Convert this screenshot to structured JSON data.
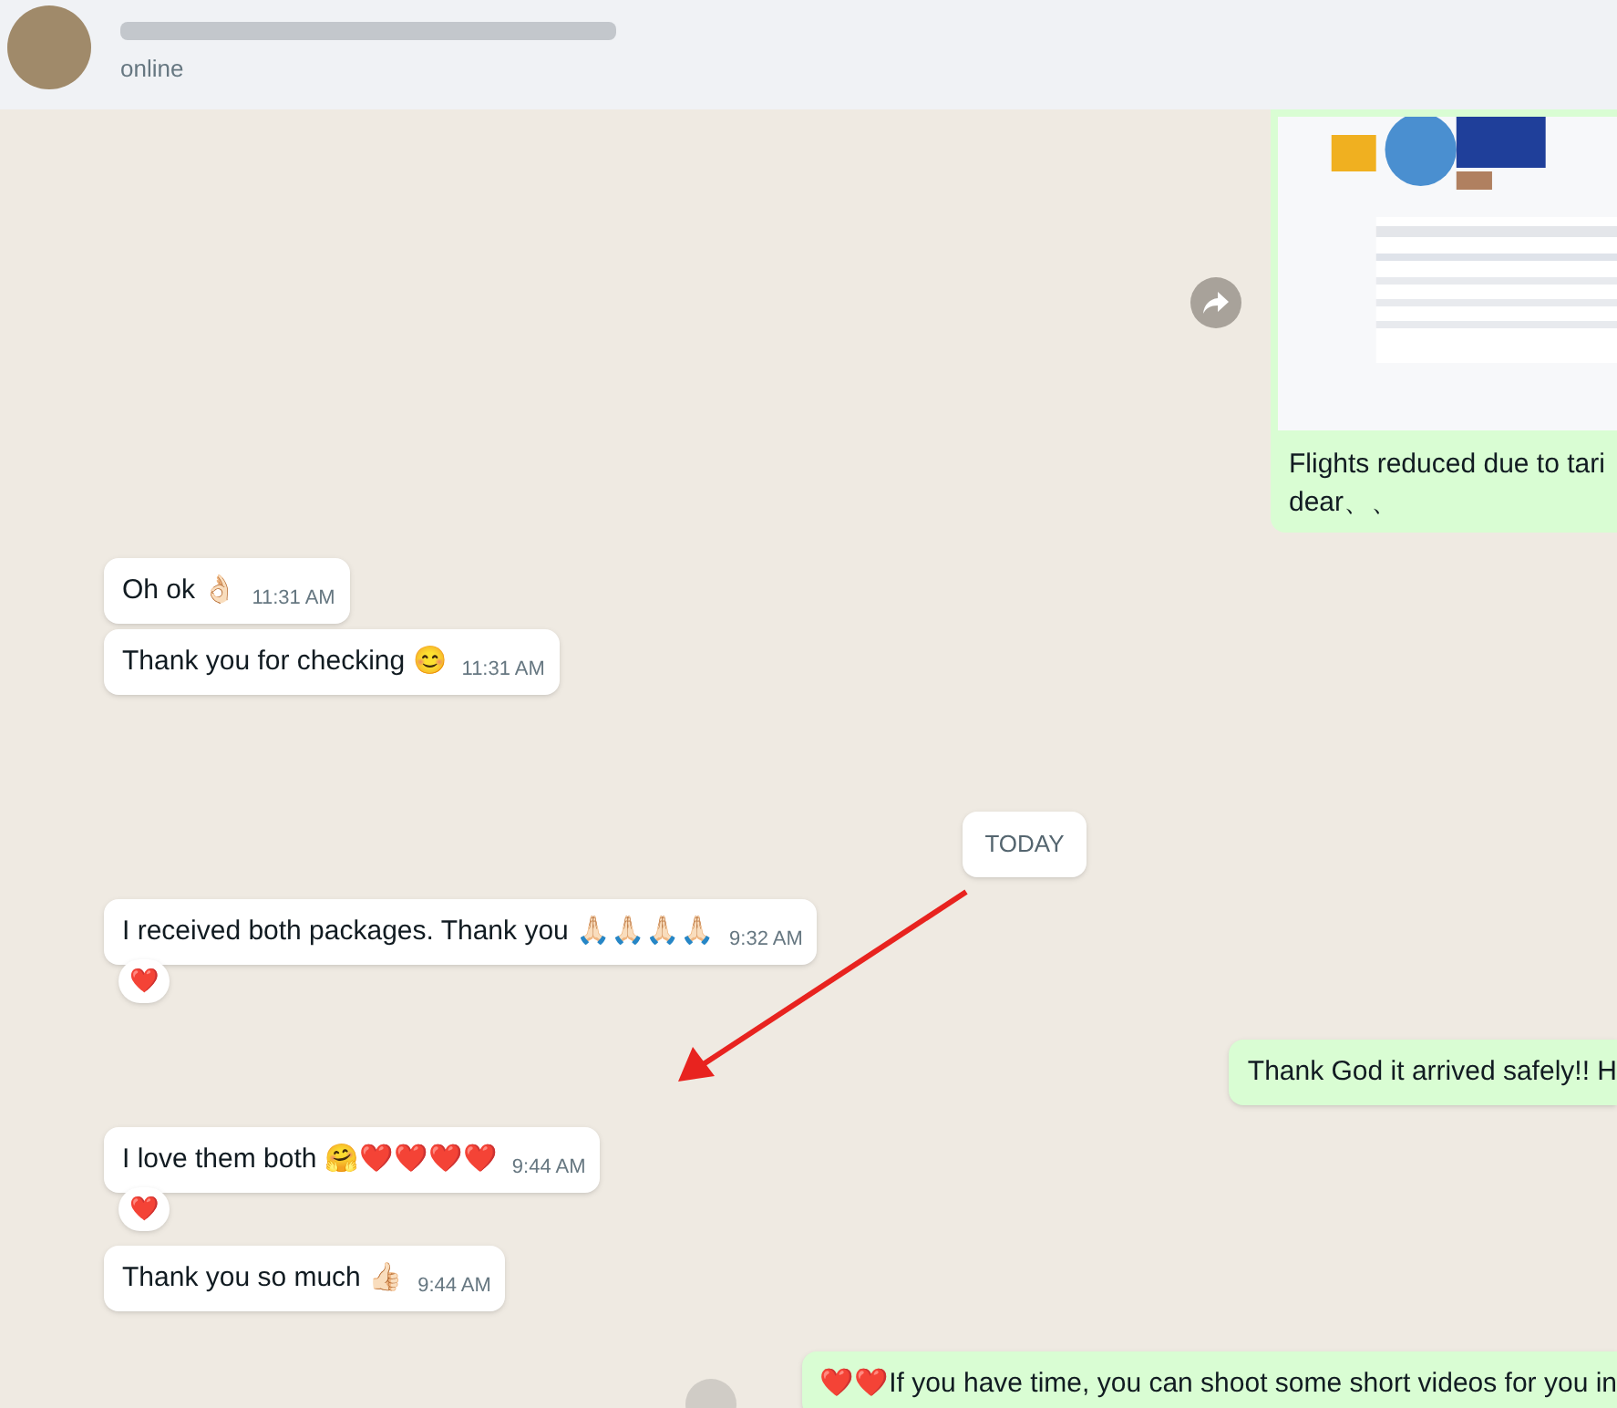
{
  "header": {
    "status": "online"
  },
  "messages": [
    {
      "caption": [
        "Flights reduced due to tari",
        "dear、、"
      ]
    },
    {
      "kind": "incoming",
      "text": "Oh ok 👌🏻",
      "time": "11:31 AM",
      "reacted": false
    },
    {
      "kind": "incoming",
      "text": "Thank you for checking 😊",
      "time": "11:31 AM",
      "reacted": false
    },
    {
      "kind": "date",
      "text": "TODAY"
    },
    {
      "kind": "incoming",
      "text": "I received both packages. Thank you 🙏🏻🙏🏻🙏🏻🙏🏻",
      "time": "9:32 AM",
      "reacted": true,
      "reaction": "❤️"
    },
    {
      "kind": "outgoing",
      "text": "Thank God it arrived safely!! H"
    },
    {
      "kind": "incoming",
      "text": "I love them both 🤗❤️❤️❤️❤️",
      "time": "9:44 AM",
      "reacted": true,
      "reaction": "❤️"
    },
    {
      "kind": "incoming",
      "text": "Thank you so much 👍🏻",
      "time": "9:44 AM",
      "reacted": false
    },
    {
      "kind": "outgoing",
      "text": "❤️❤️If you have time, you can shoot some short videos for you in"
    }
  ]
}
